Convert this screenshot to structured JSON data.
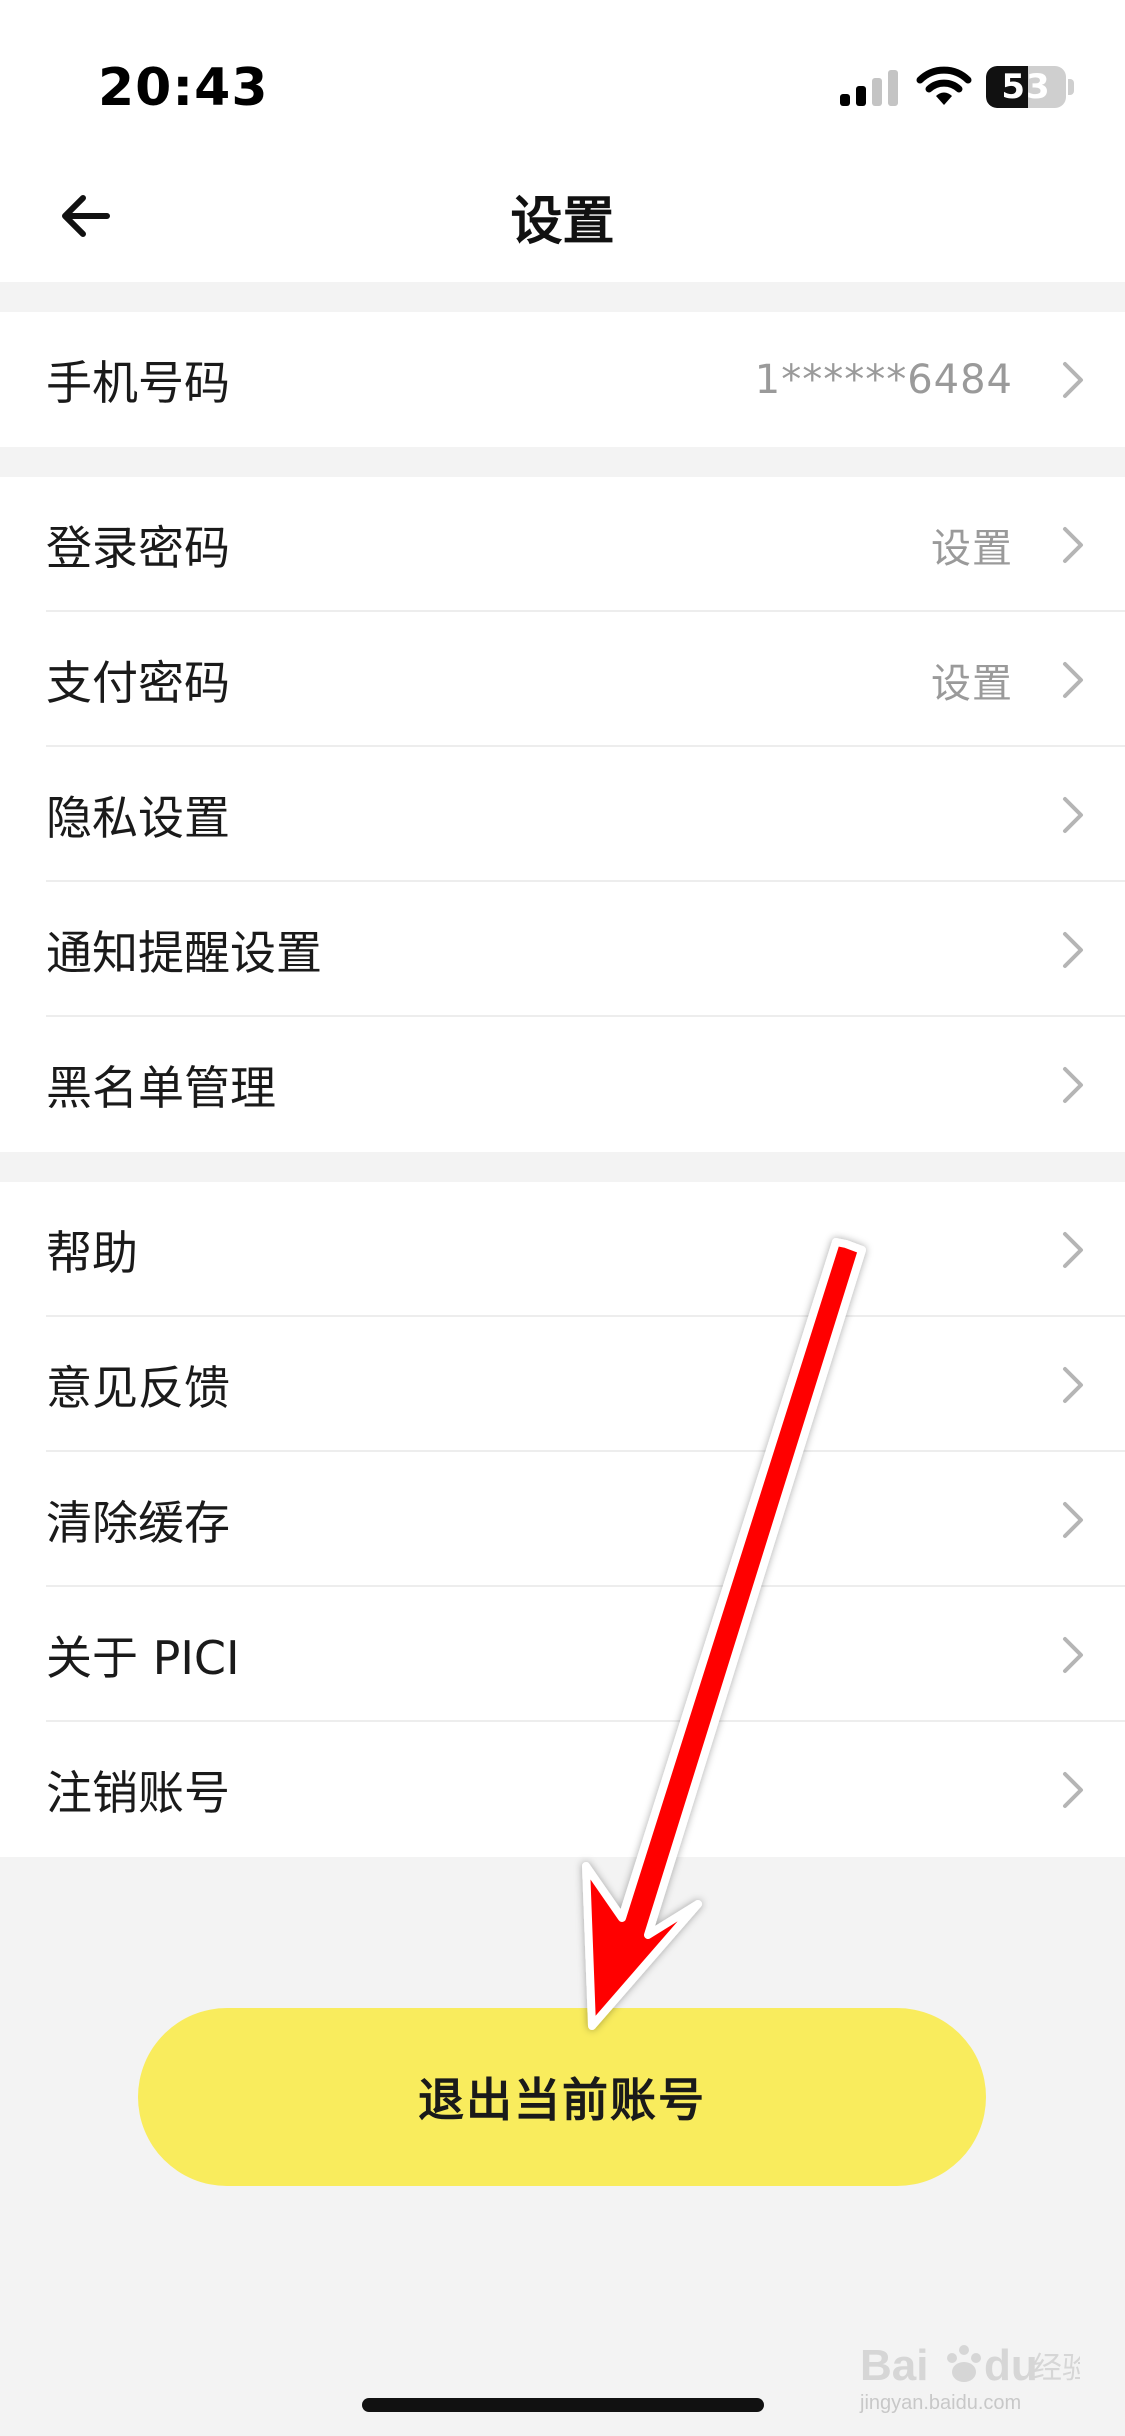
{
  "status_bar": {
    "time": "20:43",
    "battery_level": "53",
    "icons": [
      "signal-icon",
      "wifi-icon",
      "battery-icon"
    ]
  },
  "nav": {
    "title": "设置",
    "back_icon": "arrow-left-icon"
  },
  "groups": [
    {
      "items": [
        {
          "label": "手机号码",
          "value": "1******6484"
        }
      ]
    },
    {
      "items": [
        {
          "label": "登录密码",
          "value": "设置"
        },
        {
          "label": "支付密码",
          "value": "设置"
        },
        {
          "label": "隐私设置",
          "value": ""
        },
        {
          "label": "通知提醒设置",
          "value": ""
        },
        {
          "label": "黑名单管理",
          "value": ""
        }
      ]
    },
    {
      "items": [
        {
          "label": "帮助",
          "value": ""
        },
        {
          "label": "意见反馈",
          "value": ""
        },
        {
          "label": "清除缓存",
          "value": ""
        },
        {
          "label": "关于 PICI",
          "value": ""
        },
        {
          "label": "注销账号",
          "value": ""
        }
      ]
    }
  ],
  "logout_button": {
    "label": "退出当前账号"
  },
  "colors": {
    "accent_yellow": "#f9ec5d",
    "annotation_red": "#ff0000",
    "background": "#f3f3f3",
    "secondary_text": "#9a9a9a"
  },
  "watermark": {
    "logo": "Baidu经验",
    "url": "jingyan.baidu.com"
  }
}
